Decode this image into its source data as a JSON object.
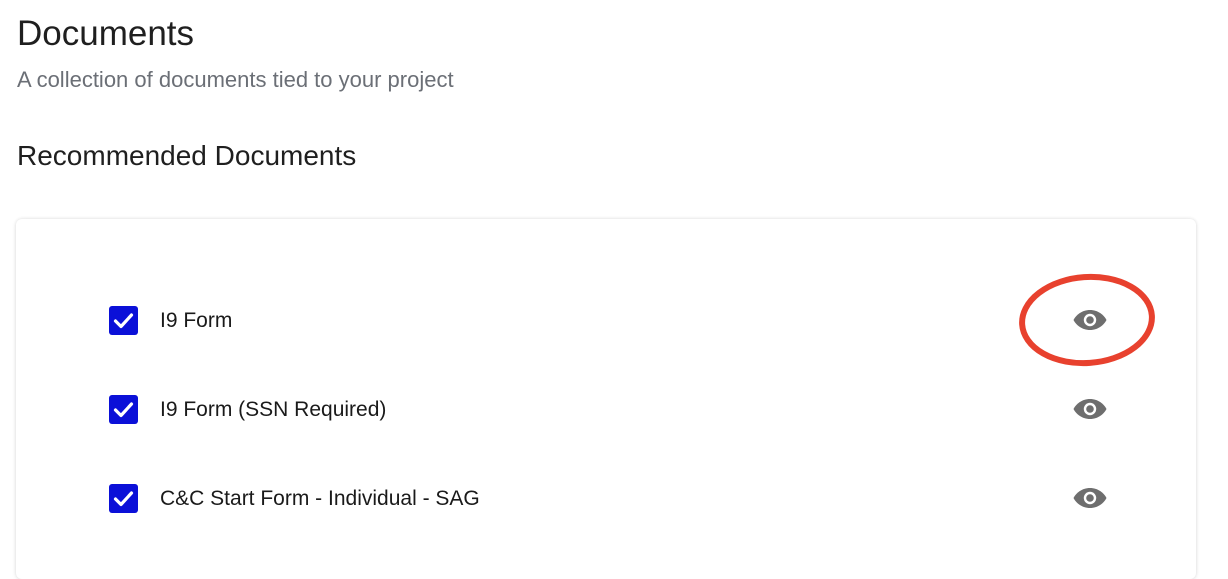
{
  "header": {
    "title": "Documents",
    "subtitle": "A collection of documents tied to your project"
  },
  "section": {
    "title": "Recommended Documents"
  },
  "documents": [
    {
      "label": "I9 Form",
      "checked": true
    },
    {
      "label": "I9 Form (SSN Required)",
      "checked": true
    },
    {
      "label": "C&C Start Form - Individual - SAG",
      "checked": true
    }
  ],
  "icons": {
    "checkbox": "check-icon",
    "view": "eye-icon"
  },
  "colors": {
    "checkbox_fill": "#0b10d8",
    "eye_icon": "#6e6e6e",
    "annotation_ring": "#e8412e"
  }
}
